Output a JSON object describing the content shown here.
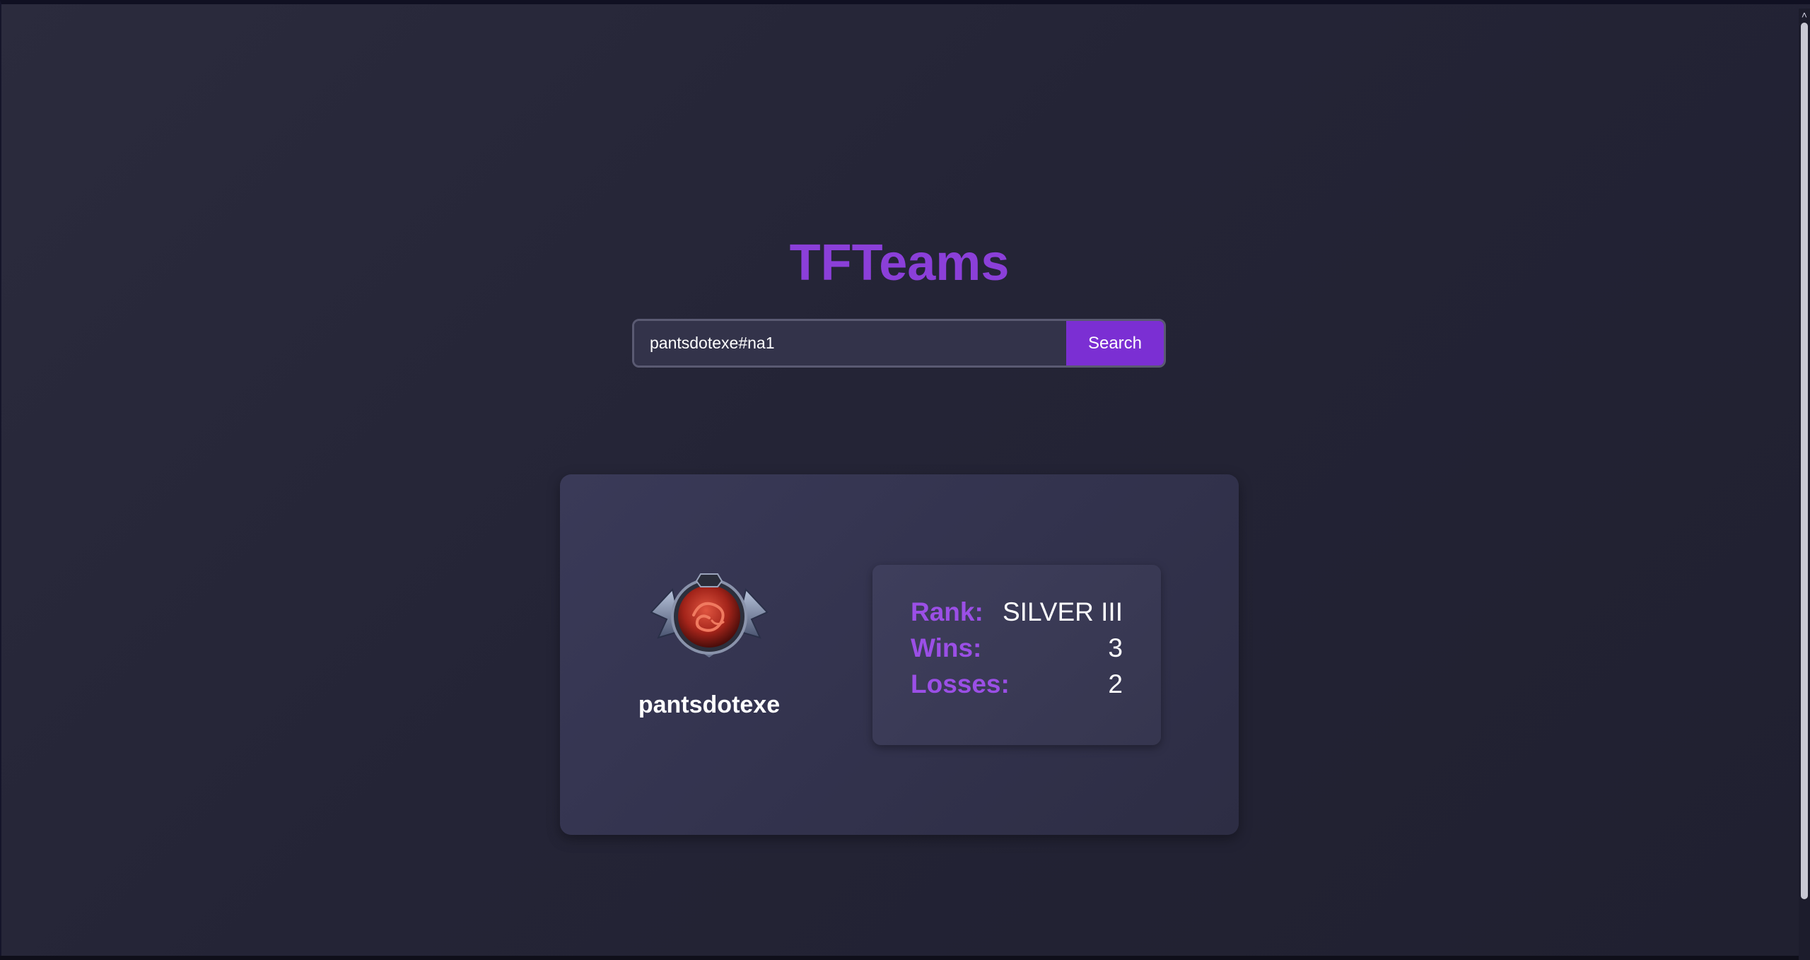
{
  "app": {
    "title": "TFTeams"
  },
  "search": {
    "value": "pantsdotexe#na1",
    "button_label": "Search"
  },
  "profile": {
    "username": "pantsdotexe",
    "avatar_icon": "summoner-avatar-icon"
  },
  "stats": {
    "rank_label": "Rank:",
    "rank_value": "SILVER III",
    "wins_label": "Wins:",
    "wins_value": "3",
    "losses_label": "Losses:",
    "losses_value": "2"
  },
  "colors": {
    "accent": "#8b3fd9",
    "button": "#7b2fd3",
    "background": "#242436"
  }
}
